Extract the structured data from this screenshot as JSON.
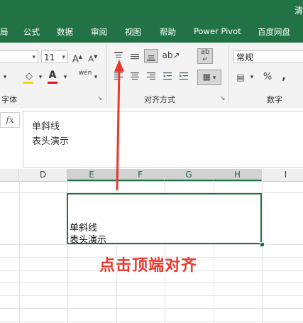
{
  "title_fragment": "清",
  "tabs": [
    {
      "label": "局"
    },
    {
      "label": "公式"
    },
    {
      "label": "数据"
    },
    {
      "label": "审阅"
    },
    {
      "label": "视图"
    },
    {
      "label": "帮助"
    },
    {
      "label": "Power Pivot"
    },
    {
      "label": "百度网盘"
    }
  ],
  "ribbon": {
    "font_size": "11",
    "grow_font": "A",
    "shrink_font": "A",
    "wen_label": "wén",
    "wrap_icon": "ab",
    "number_format": "常规",
    "percent": "%",
    "comma": ",",
    "group_font": "字体",
    "group_align": "对齐方式",
    "group_number": "数字"
  },
  "formula_bar": {
    "fx": "fx",
    "line1": "单斜线",
    "line2": "表头演示"
  },
  "columns": [
    "D",
    "E",
    "F",
    "G",
    "H",
    "I"
  ],
  "selected_cell": {
    "line1": "单斜线",
    "line2": "表头演示"
  },
  "annotation": {
    "caption": "点击顶端对齐",
    "color": "#e8372b"
  },
  "colors": {
    "accent": "#217346"
  }
}
